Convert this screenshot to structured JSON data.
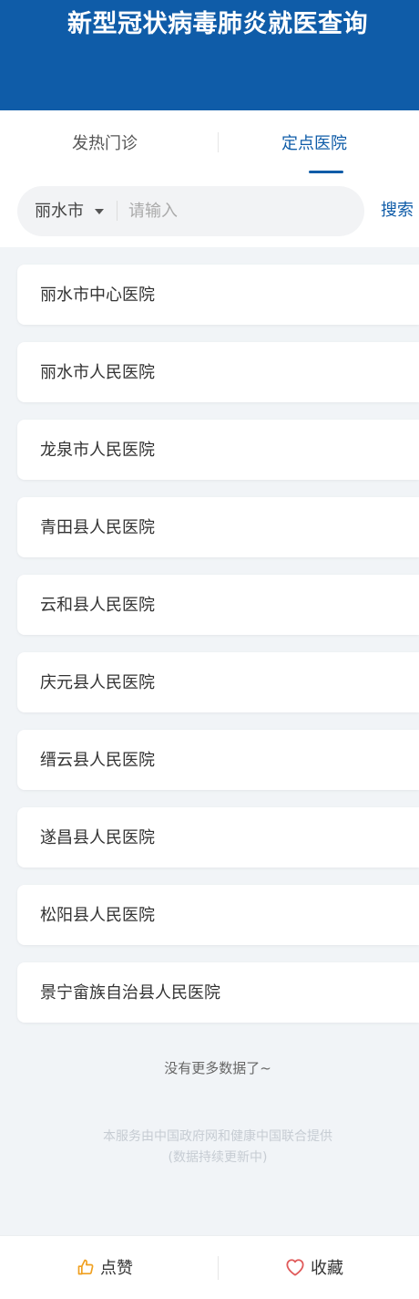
{
  "header": {
    "title": "新型冠状病毒肺炎就医查询"
  },
  "tabs": [
    {
      "label": "发热门诊",
      "active": false
    },
    {
      "label": "定点医院",
      "active": true
    }
  ],
  "search": {
    "city": "丽水市",
    "placeholder": "请输入",
    "value": "",
    "button_label": "搜索"
  },
  "hospitals": [
    "丽水市中心医院",
    "丽水市人民医院",
    "龙泉市人民医院",
    "青田县人民医院",
    "云和县人民医院",
    "庆元县人民医院",
    "缙云县人民医院",
    "遂昌县人民医院",
    "松阳县人民医院",
    "景宁畲族自治县人民医院"
  ],
  "footer": {
    "no_more": "没有更多数据了~",
    "provider_line1": "本服务由中国政府网和健康中国联合提供",
    "provider_line2": "(数据持续更新中)"
  },
  "bottom_bar": {
    "like_label": "点赞",
    "favorite_label": "收藏"
  },
  "colors": {
    "brand": "#0f5ca8",
    "background": "#f1f4f7",
    "like_icon": "#f0a020",
    "favorite_icon": "#e05a5a"
  },
  "icons": {
    "like": "thumbs-up-icon",
    "favorite": "heart-icon",
    "dropdown": "caret-down-icon"
  }
}
